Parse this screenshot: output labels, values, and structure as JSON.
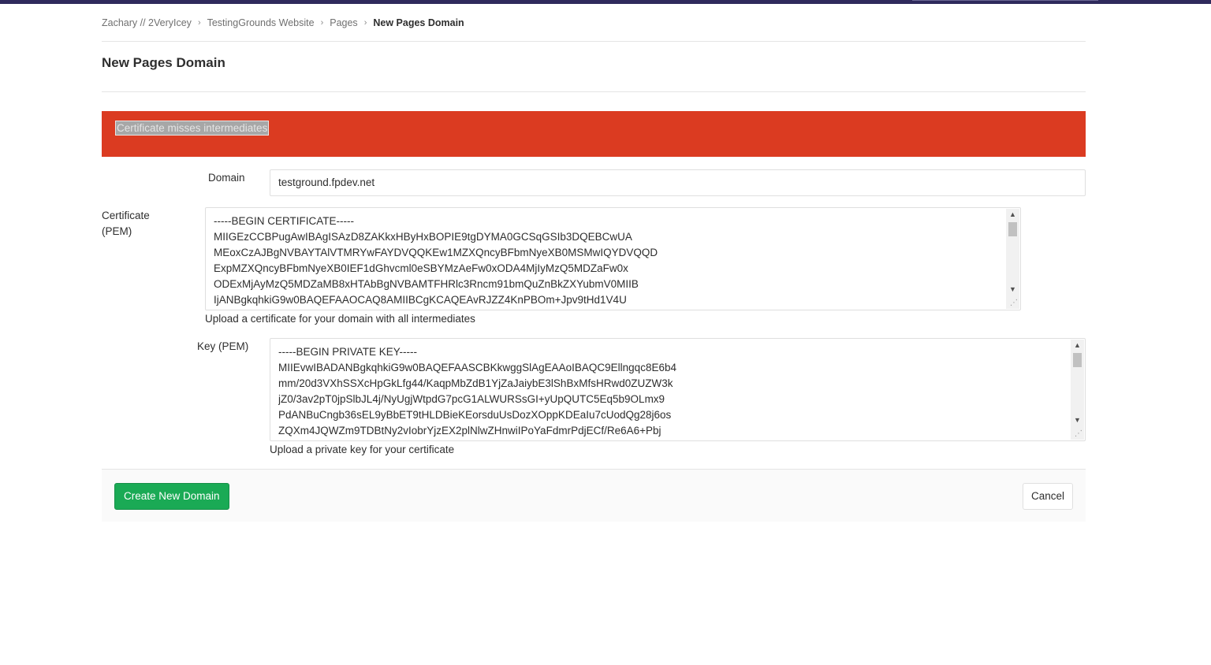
{
  "breadcrumb": {
    "items": [
      "Zachary // 2VeryIcey",
      "TestingGrounds Website",
      "Pages"
    ],
    "current": "New Pages Domain",
    "separator": "›"
  },
  "page": {
    "title": "New Pages Domain"
  },
  "alert": {
    "message": "Certificate misses intermediates",
    "color": "#db3b21"
  },
  "form": {
    "domain": {
      "label": "Domain",
      "value": "testground.fpdev.net"
    },
    "certificate": {
      "label_line1": "Certificate",
      "label_line2": "(PEM)",
      "value": "-----BEGIN CERTIFICATE-----\nMIIGEzCCBPugAwIBAgISAzD8ZAKkxHByHxBOPIE9tgDYMA0GCSqGSIb3DQEBCwUA\nMEoxCzAJBgNVBAYTAlVTMRYwFAYDVQQKEw1MZXQncyBFbmNyeXB0MSMwIQYDVQQD\nExpMZXQncyBFbmNyeXB0IEF1dGhvcml0eSBYMzAeFw0xODA4MjIyMzQ5MDZaFw0x\nODExMjAyMzQ5MDZaMB8xHTAbBgNVBAMTFHRlc3Rncm91bmQuZnBkZXYubmV0MIIB\nIjANBgkqhkiG9w0BAQEFAAOCAQ8AMIIBCgKCAQEAvRJZZ4KnPBOm+Jpv9tHd1V4U",
      "help": "Upload a certificate for your domain with all intermediates"
    },
    "key": {
      "label": "Key (PEM)",
      "value": "-----BEGIN PRIVATE KEY-----\nMIIEvwIBADANBgkqhkiG9w0BAQEFAASCBKkwggSlAgEAAoIBAQC9Ellngqc8E6b4\nmm/20d3VXhSSXcHpGkLfg44/KaqpMbZdB1YjZaJaiybE3lShBxMfsHRwd0ZUZW3k\njZ0/3av2pT0jpSlbJL4j/NyUgjWtpdG7pcG1ALWURSsGI+yUpQUTC5Eq5b9OLmx9\nPdANBuCngb36sEL9yBbET9tHLDBieKEorsduUsDozXOppKDEaIu7cUodQg28j6os\nZQXm4JQWZm9TDBtNy2vIobrYjzEX2plNlwZHnwiIPoYaFdmrPdjECf/Re6A6+Pbj",
      "help": "Upload a private key for your certificate"
    }
  },
  "actions": {
    "create_label": "Create New Domain",
    "cancel_label": "Cancel",
    "create_color": "#1aaa55"
  },
  "icons": {
    "scroll_up": "▲",
    "scroll_down": "▼",
    "resize": "⋰"
  }
}
